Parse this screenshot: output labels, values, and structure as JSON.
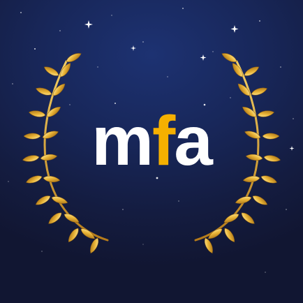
{
  "logo": {
    "text": "mfa",
    "letters": [
      "m",
      "f",
      "a"
    ],
    "letter_colors": [
      "#ffffff",
      "#f5b000",
      "#ffffff"
    ]
  },
  "colors": {
    "background_top": "#1d3272",
    "background_bottom": "#111632",
    "laurel_gold": "#e9b437",
    "laurel_highlight": "#fff1a8",
    "laurel_shadow": "#9a6411",
    "star": "#ffffff"
  },
  "icons": [
    "laurel-wreath-icon",
    "star-icon"
  ]
}
